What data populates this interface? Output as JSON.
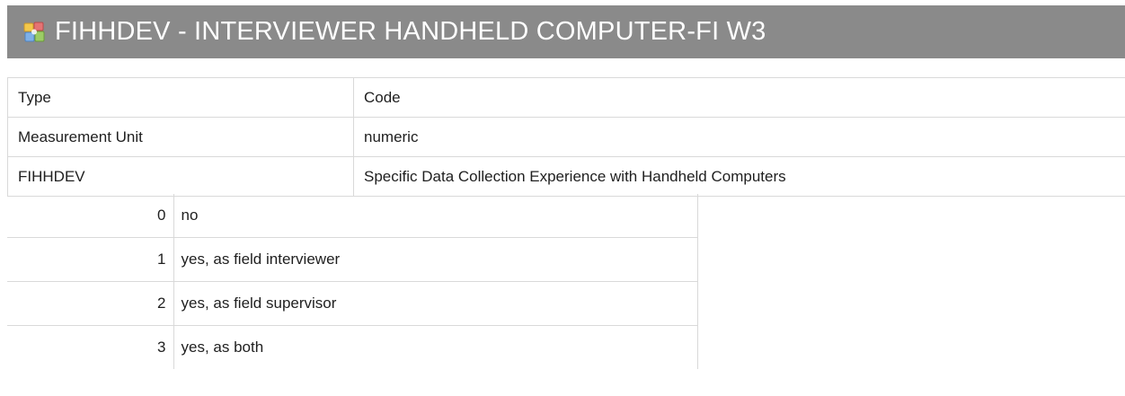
{
  "header": {
    "title": "FIHHDEV - INTERVIEWER HANDHELD COMPUTER-FI W3",
    "icon": "variable-puzzle-icon"
  },
  "properties": [
    {
      "key": "Type",
      "value": "Code"
    },
    {
      "key": "Measurement Unit",
      "value": "numeric"
    },
    {
      "key": "FIHHDEV",
      "value": "Specific Data Collection Experience with Handheld Computers"
    }
  ],
  "codes": [
    {
      "code": "0",
      "label": "no"
    },
    {
      "code": "1",
      "label": "yes, as field interviewer"
    },
    {
      "code": "2",
      "label": "yes, as field supervisor"
    },
    {
      "code": "3",
      "label": "yes, as both"
    }
  ],
  "colors": {
    "title_bar": "#8a8a8a",
    "title_text": "#ffffff",
    "grid_line": "#d9d9d9"
  }
}
